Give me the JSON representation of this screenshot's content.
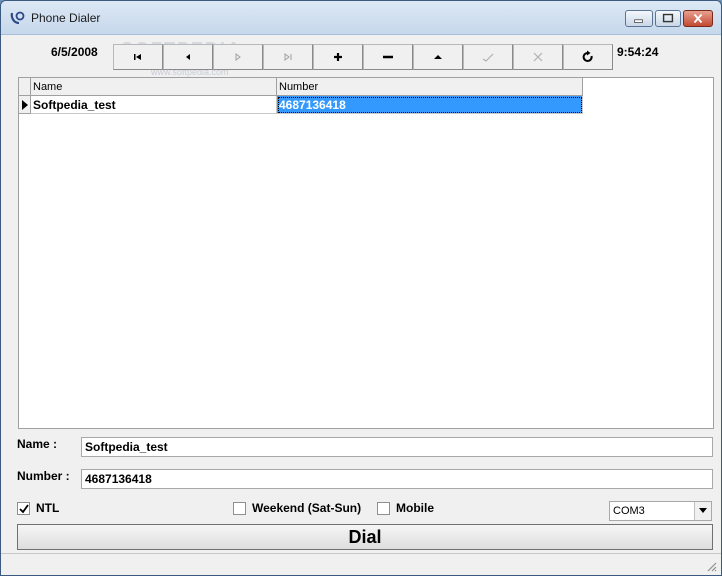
{
  "window": {
    "title": "Phone Dialer"
  },
  "header": {
    "date": "6/5/2008",
    "time": "9:54:24"
  },
  "watermark": {
    "text": "SOFTPEDIA",
    "sub": "www.softpedia.com"
  },
  "navigator": {
    "buttons": [
      {
        "name": "first-record",
        "icon": "first-icon",
        "enabled": true
      },
      {
        "name": "prior-record",
        "icon": "prior-icon",
        "enabled": true
      },
      {
        "name": "next-record",
        "icon": "next-icon",
        "enabled": false
      },
      {
        "name": "last-record",
        "icon": "last-icon",
        "enabled": false
      },
      {
        "name": "insert-record",
        "icon": "plus-icon",
        "enabled": true
      },
      {
        "name": "delete-record",
        "icon": "minus-icon",
        "enabled": true
      },
      {
        "name": "edit-record",
        "icon": "up-icon",
        "enabled": true
      },
      {
        "name": "post-record",
        "icon": "check-icon",
        "enabled": false
      },
      {
        "name": "cancel-record",
        "icon": "x-icon",
        "enabled": false
      },
      {
        "name": "refresh-records",
        "icon": "refresh-icon",
        "enabled": true
      }
    ]
  },
  "grid": {
    "columns": [
      "Name",
      "Number"
    ],
    "rows": [
      {
        "name": "Softpedia_test",
        "number": "4687136418"
      }
    ]
  },
  "form": {
    "name_label": "Name :",
    "name_value": "Softpedia_test",
    "number_label": "Number :",
    "number_value": "4687136418"
  },
  "options": {
    "ntl": {
      "label": "NTL",
      "checked": true
    },
    "weekend": {
      "label": "Weekend (Sat-Sun)",
      "checked": false
    },
    "mobile": {
      "label": "Mobile",
      "checked": false
    }
  },
  "port": {
    "selected": "COM3"
  },
  "actions": {
    "dial_label": "Dial"
  }
}
